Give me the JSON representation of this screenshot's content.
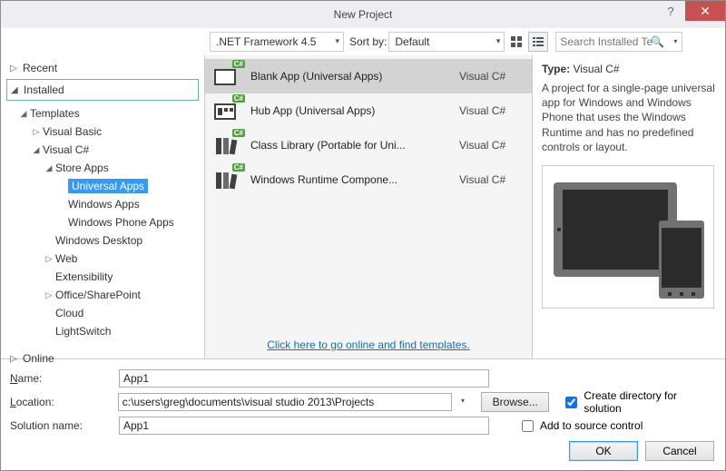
{
  "title": "New Project",
  "nav": {
    "recent": "Recent",
    "installed": "Installed",
    "online": "Online"
  },
  "tree": {
    "templates": "Templates",
    "vb": "Visual Basic",
    "vcs": "Visual C#",
    "store": "Store Apps",
    "universal": "Universal Apps",
    "winapps": "Windows Apps",
    "wpapps": "Windows Phone Apps",
    "windesk": "Windows Desktop",
    "web": "Web",
    "ext": "Extensibility",
    "osp": "Office/SharePoint",
    "cloud": "Cloud",
    "ls": "LightSwitch"
  },
  "toolbar": {
    "framework": ".NET Framework 4.5",
    "sortby_label": "Sort by:",
    "sortby_value": "Default",
    "search_placeholder": "Search Installed Te"
  },
  "templates": [
    {
      "name": "Blank App (Universal Apps)",
      "lang": "Visual C#"
    },
    {
      "name": "Hub App (Universal Apps)",
      "lang": "Visual C#"
    },
    {
      "name": "Class Library (Portable for Uni...",
      "lang": "Visual C#"
    },
    {
      "name": "Windows Runtime Compone...",
      "lang": "Visual C#"
    }
  ],
  "online_link": "Click here to go online and find templates.",
  "detail": {
    "type_label": "Type:",
    "type_value": "Visual C#",
    "description": "A project for a single-page universal app for Windows and Windows Phone that uses the Windows Runtime and has no predefined controls or layout."
  },
  "form": {
    "name_label_pre": "N",
    "name_label_post": "ame:",
    "name_value": "App1",
    "location_label_pre": "L",
    "location_label_post": "ocation:",
    "location_value": "c:\\users\\greg\\documents\\visual studio 2013\\Projects",
    "browse": "Browse...",
    "solution_label": "Solution name:",
    "solution_value": "App1",
    "create_dir": "Create directory for solution",
    "add_src": "Add to source control"
  },
  "buttons": {
    "ok": "OK",
    "cancel": "Cancel"
  }
}
